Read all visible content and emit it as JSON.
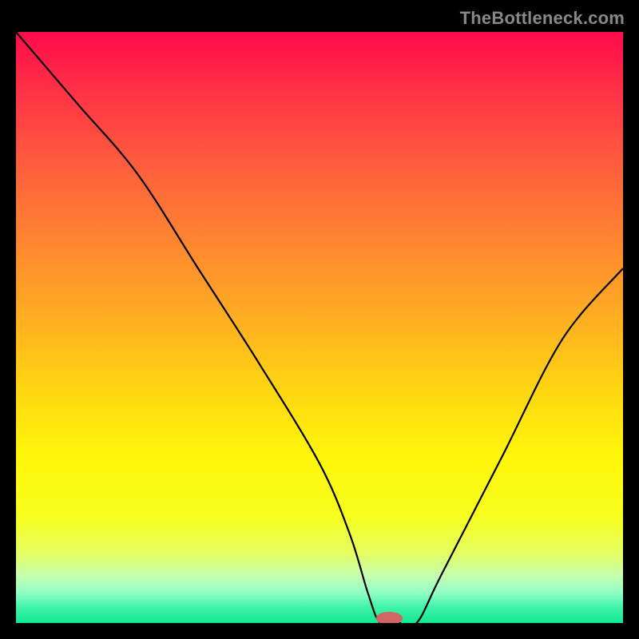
{
  "watermark": "TheBottleneck.com",
  "chart_data": {
    "type": "line",
    "title": "",
    "xlabel": "",
    "ylabel": "",
    "xlim": [
      0,
      100
    ],
    "ylim": [
      0,
      100
    ],
    "x": [
      0,
      10,
      20,
      30,
      40,
      50,
      55,
      58,
      60,
      63,
      66,
      70,
      80,
      90,
      100
    ],
    "values": [
      100,
      88,
      76,
      60,
      44,
      27,
      15,
      5,
      0,
      0,
      0,
      8,
      28,
      48,
      60
    ],
    "curve_color": "#000000",
    "curve_width": 2.2,
    "marker": {
      "x": 61.5,
      "y": 0.8,
      "rx": 2.2,
      "ry": 1.1,
      "color": "#d06565"
    },
    "gradient_stops": [
      {
        "offset": 0.0,
        "color": "#ff0b4b"
      },
      {
        "offset": 0.1,
        "color": "#ff3146"
      },
      {
        "offset": 0.22,
        "color": "#ff5c3d"
      },
      {
        "offset": 0.35,
        "color": "#ff8431"
      },
      {
        "offset": 0.48,
        "color": "#ffad22"
      },
      {
        "offset": 0.6,
        "color": "#ffd413"
      },
      {
        "offset": 0.72,
        "color": "#fff70a"
      },
      {
        "offset": 0.82,
        "color": "#f7ff1f"
      },
      {
        "offset": 0.88,
        "color": "#e6ff60"
      },
      {
        "offset": 0.92,
        "color": "#c7ffb0"
      },
      {
        "offset": 0.95,
        "color": "#8effc6"
      },
      {
        "offset": 0.975,
        "color": "#3cf2a6"
      },
      {
        "offset": 1.0,
        "color": "#12e894"
      }
    ]
  }
}
